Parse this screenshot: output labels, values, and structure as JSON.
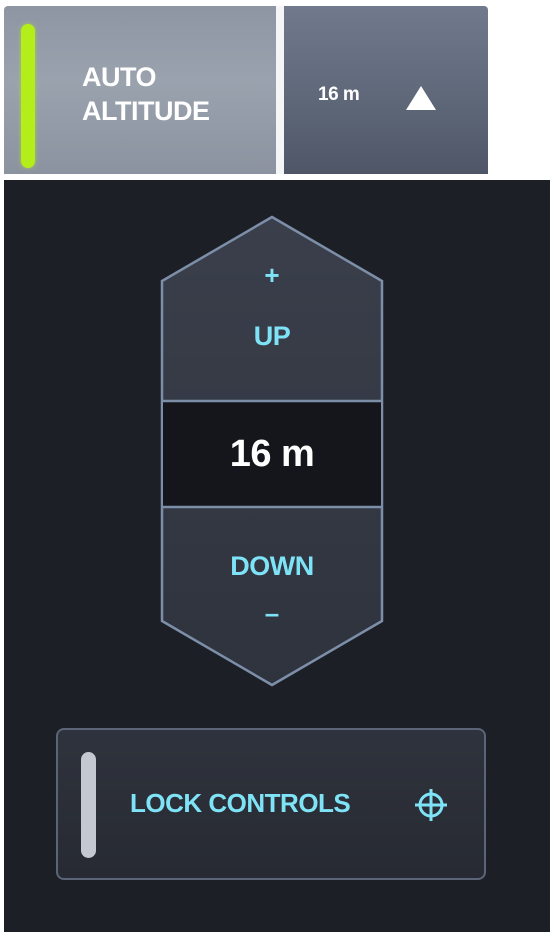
{
  "top_bar": {
    "auto_altitude": {
      "line1": "AUTO",
      "line2": "ALTITUDE",
      "indicator_color": "#b4ee1a",
      "active": true
    },
    "altitude_dropdown": {
      "value": "16 m",
      "icon": "caret-up-icon"
    }
  },
  "stepper": {
    "plus_symbol": "+",
    "up_label": "UP",
    "value": "16 m",
    "down_label": "DOWN",
    "minus_symbol": "–"
  },
  "lock_controls": {
    "label": "LOCK CONTROLS",
    "icon": "crosshair-icon",
    "active": false
  },
  "colors": {
    "accent": "#7fe3f7",
    "panel_bg": "#1c1f26",
    "indicator_on": "#b4ee1a",
    "indicator_off": "#c4c8d0"
  }
}
